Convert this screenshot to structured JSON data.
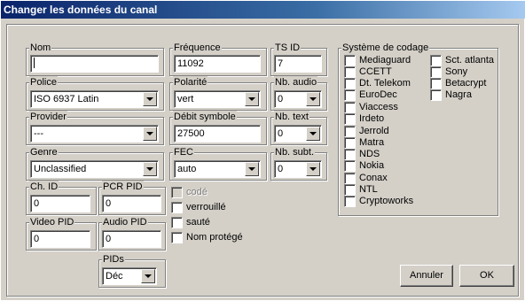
{
  "window": {
    "title": "Changer les données du canal"
  },
  "fields": {
    "nom": {
      "label": "Nom",
      "value": ""
    },
    "frequence": {
      "label": "Fréquence",
      "value": "11092"
    },
    "ts_id": {
      "label": "TS ID",
      "value": "7"
    },
    "police": {
      "label": "Police",
      "value": "ISO 6937 Latin"
    },
    "polarite": {
      "label": "Polarité",
      "value": "vert"
    },
    "nb_audio": {
      "label": "Nb. audio",
      "value": "0"
    },
    "provider": {
      "label": "Provider",
      "value": "---"
    },
    "debit_symbole": {
      "label": "Débit symbole",
      "value": "27500"
    },
    "nb_text": {
      "label": "Nb. text",
      "value": "0"
    },
    "genre": {
      "label": "Genre",
      "value": "Unclassified"
    },
    "fec": {
      "label": "FEC",
      "value": "auto"
    },
    "nb_subt": {
      "label": "Nb. subt.",
      "value": "0"
    },
    "ch_id": {
      "label": "Ch. ID",
      "value": "0"
    },
    "pcr_pid": {
      "label": "PCR PID",
      "value": "0"
    },
    "video_pid": {
      "label": "Video PID",
      "value": "0"
    },
    "audio_pid": {
      "label": "Audio PID",
      "value": "0"
    },
    "pids": {
      "label": "PIDs",
      "value": "Déc"
    }
  },
  "flags": [
    {
      "label": "codé",
      "checked": false,
      "disabled": true
    },
    {
      "label": "verrouillé",
      "checked": false,
      "disabled": false
    },
    {
      "label": "sauté",
      "checked": false,
      "disabled": false
    },
    {
      "label": "Nom protégé",
      "checked": false,
      "disabled": false
    }
  ],
  "encoding": {
    "label": "Système de codage",
    "col1": [
      "Mediaguard",
      "CCETT",
      "Dt. Telekom",
      "EuroDec",
      "Viaccess",
      "Irdeto",
      "Jerrold",
      "Matra",
      "NDS",
      "Nokia",
      "Conax",
      "NTL",
      "Cryptoworks"
    ],
    "col2": [
      "Sct. atlanta",
      "Sony",
      "Betacrypt",
      "Nagra"
    ]
  },
  "buttons": {
    "cancel": "Annuler",
    "ok": "OK"
  }
}
